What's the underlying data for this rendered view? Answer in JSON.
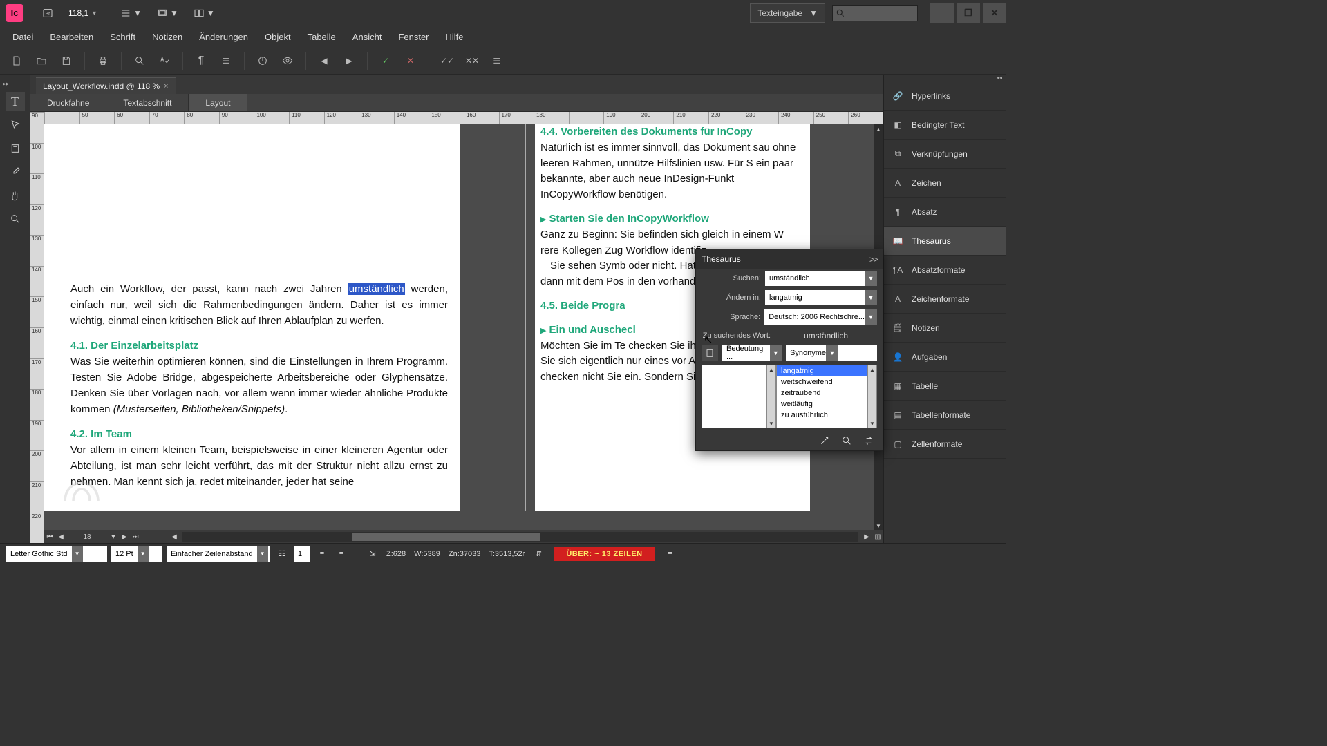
{
  "app": {
    "logo_text": "Ic",
    "zoom": "118,1"
  },
  "workspace": {
    "label": "Texteingabe"
  },
  "window": {
    "min": "_",
    "max": "❐",
    "close": "✕"
  },
  "menu": [
    "Datei",
    "Bearbeiten",
    "Schrift",
    "Notizen",
    "Änderungen",
    "Objekt",
    "Tabelle",
    "Ansicht",
    "Fenster",
    "Hilfe"
  ],
  "doc_tab": {
    "title": "Layout_Workflow.indd @ 118 %",
    "close": "×"
  },
  "view_tabs": [
    "Druckfahne",
    "Textabschnitt",
    "Layout"
  ],
  "hruler": [
    "",
    "50",
    "60",
    "70",
    "80",
    "90",
    "100",
    "110",
    "120",
    "130",
    "140",
    "150",
    "160",
    "170",
    "180",
    "",
    "190",
    "200",
    "210",
    "220",
    "230",
    "240",
    "250",
    "260"
  ],
  "vruler": [
    "90",
    "100",
    "110",
    "120",
    "130",
    "140",
    "150",
    "160",
    "170",
    "180",
    "190",
    "200",
    "210",
    "220"
  ],
  "page_nav": {
    "page": "18"
  },
  "left_page": {
    "p1_pre": "Auch ein Workflow, der passt, kann nach zwei Jahren ",
    "p1_hl": "umständlich",
    "p1_post": " werden, einfach nur, weil sich die Rahmenbedingungen ändern. Daher ist es immer wichtig, einmal einen kritischen Blick auf Ihren Ablaufplan zu werfen.",
    "h41": "4.1.   Der Einzelarbeitsplatz",
    "p2a": "Was Sie weiterhin optimieren können, sind die Einstellungen in Ihrem Programm. Testen Sie Adobe Bridge, abgespeicherte Arbeitsbereiche oder Glyphensätze. Denken Sie über Vorlagen nach, vor allem wenn immer wieder ähnliche Produkte kommen ",
    "p2b": "(Musterseiten, Bibliotheken/Snippets)",
    "p2c": ".",
    "h42": "4.2.   Im Team",
    "p3": "Vor allem in einem kleinen Team, beispielsweise in einer kleineren Agentur oder Abteilung, ist man sehr leicht verführt, das mit der Struktur nicht allzu ernst zu nehmen. Man kennt sich ja, redet miteinander, jeder hat seine"
  },
  "right_page": {
    "h44": "4.4.   Vorbereiten des Dokuments für InCopy",
    "p1": "Natürlich ist es immer sinnvoll, das Dokument sau ohne leeren Rahmen, unnütze Hilfslinien usw. Für S ein paar bekannte, aber auch neue InDesign-Funkt InCopyWorkflow benötigen.",
    "sub1": "Starten Sie den InCopyWorkflow",
    "p2": "Ganz zu Beginn: Sie befinden sich gleich in einem W rere Kollegen Zug Workflow identifiz",
    "p2b": "Sie sehen Symb oder nicht. Hat ein ben. Auch Bildrah dann mit dem Pos in den vorhandene",
    "h45": "4.5.   Beide Progra",
    "sub2": "Ein und Auschecl",
    "p3": "Möchten Sie im Te checken Sie ihn wi le Starter andersh Sie sich eigentlich nur eines vor Augen halten: Um e ten, checken nicht Sie ein. Sondern Sie holen den"
  },
  "thesaurus": {
    "title": "Thesaurus",
    "collapse": ">>",
    "labels": {
      "search": "Suchen:",
      "change": "Ändern in:",
      "lang": "Sprache:",
      "lookup": "Zu suchendes Wort:"
    },
    "search_val": "umständlich",
    "change_val": "langatmig",
    "lang_val": "Deutsch: 2006 Rechtschre...",
    "lookup_val": "umständlich",
    "meaning_sel": "Bedeutung ...",
    "rel_sel": "Synonyme",
    "synonyms": [
      "langatmig",
      "weitschweifend",
      "zeitraubend",
      "weitläufig",
      "zu ausführlich"
    ]
  },
  "right_dock": [
    {
      "icon": "link",
      "label": "Hyperlinks"
    },
    {
      "icon": "cond",
      "label": "Bedingter Text"
    },
    {
      "icon": "chain",
      "label": "Verknüpfungen"
    },
    {
      "icon": "char",
      "label": "Zeichen"
    },
    {
      "icon": "para",
      "label": "Absatz"
    },
    {
      "icon": "thes",
      "label": "Thesaurus",
      "active": true
    },
    {
      "icon": "pstyle",
      "label": "Absatzformate"
    },
    {
      "icon": "cstyle",
      "label": "Zeichenformate"
    },
    {
      "icon": "note",
      "label": "Notizen"
    },
    {
      "icon": "task",
      "label": "Aufgaben"
    },
    {
      "icon": "table",
      "label": "Tabelle"
    },
    {
      "icon": "tfmt",
      "label": "Tabellenformate"
    },
    {
      "icon": "cfmt",
      "label": "Zellenformate"
    }
  ],
  "status": {
    "font": "Letter Gothic Std",
    "size": "12 Pt",
    "leading": "Einfacher Zeilenabstand",
    "col": "1",
    "z": "Z:628",
    "w": "W:5389",
    "zn": "Zn:37033",
    "t": "T:3513,52r",
    "overset": "ÜBER:  ~ 13 ZEILEN"
  }
}
